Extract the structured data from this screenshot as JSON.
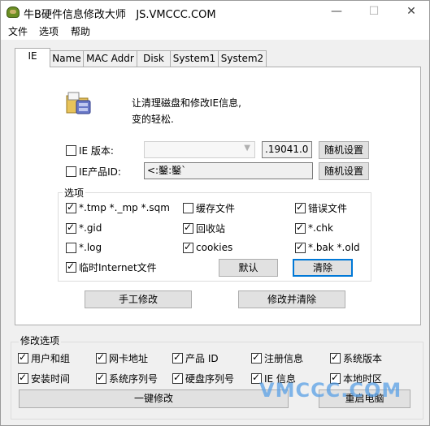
{
  "window": {
    "title": "牛B硬件信息修改大师   JS.VMCCC.COM",
    "minimize": "—",
    "maximize": "☐",
    "close": "✕"
  },
  "menu": [
    "文件",
    "选项",
    "帮助"
  ],
  "tabs": [
    "IE",
    "Name",
    "MAC Addr",
    "Disk",
    "System1",
    "System2"
  ],
  "ie_tab": {
    "description_line1": "让清理磁盘和修改IE信息,",
    "description_line2": "变的轻松.",
    "ie_version_label": "IE 版本:",
    "ie_version_value": ".19041.0",
    "ie_product_label": "IE产品ID:",
    "ie_product_value": "<:鑿:鑿`",
    "random_button": "随机设置",
    "options_title": "选项",
    "options": {
      "tmp": "*.tmp  *._mp  *.sqm",
      "gid": "*.gid",
      "log": "*.log",
      "temp_internet": "临时Internet文件",
      "cache": "缓存文件",
      "recycle": "回收站",
      "cookies": "cookies",
      "errors": "错误文件",
      "chk": "*.chk",
      "bak": "*.bak  *.old"
    },
    "default_button": "默认",
    "clear_button": "清除",
    "manual_button": "手工修改",
    "modify_clear_button": "修改并清除"
  },
  "modify_options": {
    "title": "修改选项",
    "items": [
      "用户和组",
      "网卡地址",
      "产品 ID",
      "注册信息",
      "系统版本",
      "安装时间",
      "系统序列号",
      "硬盘序列号",
      "IE 信息",
      "本地时区"
    ],
    "one_click_button": "一键修改",
    "restart_button": "重启电脑"
  },
  "watermark": "VMCCC.COM"
}
